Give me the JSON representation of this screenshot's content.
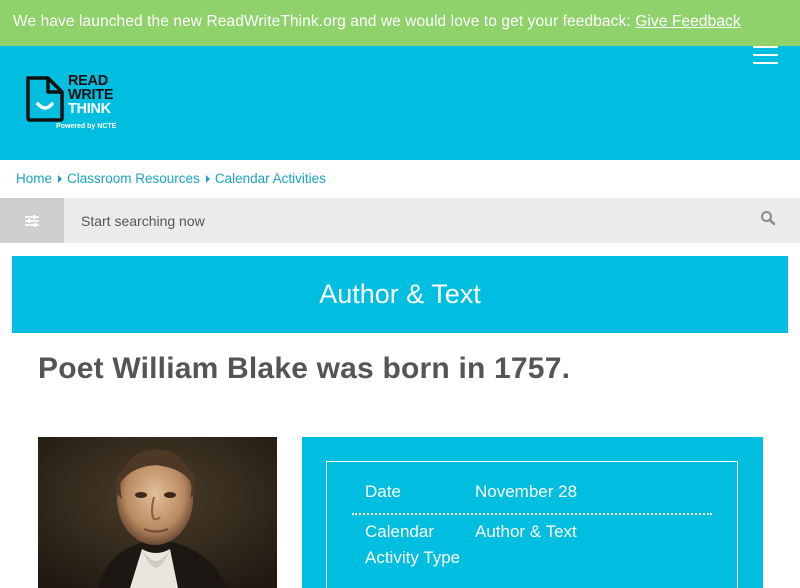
{
  "banner": {
    "message": "We have launched the new ReadWriteThink.org and we would love to get your feedback:",
    "link_label": "Give Feedback"
  },
  "logo": {
    "line1": "READ",
    "line2": "WRITE",
    "line3": "THINK",
    "tagline": "Powered by NCTE"
  },
  "header": {
    "menu_icon": "hamburger-menu-icon"
  },
  "breadcrumb": {
    "items": [
      "Home",
      "Classroom Resources",
      "Calendar Activities"
    ]
  },
  "search": {
    "placeholder": "Start searching now",
    "filter_icon": "sliders-icon",
    "search_icon": "magnifier-icon"
  },
  "category_title": "Author & Text",
  "headline": "Poet William Blake was born in 1757.",
  "details": {
    "date_label": "Date",
    "date_value": "November 28",
    "type_label": "Calendar Activity Type",
    "type_value": "Author & Text"
  },
  "colors": {
    "banner": "#8fd16b",
    "brand": "#00bedf",
    "breadcrumb_link": "#1aa3c4",
    "headline": "#555555"
  }
}
